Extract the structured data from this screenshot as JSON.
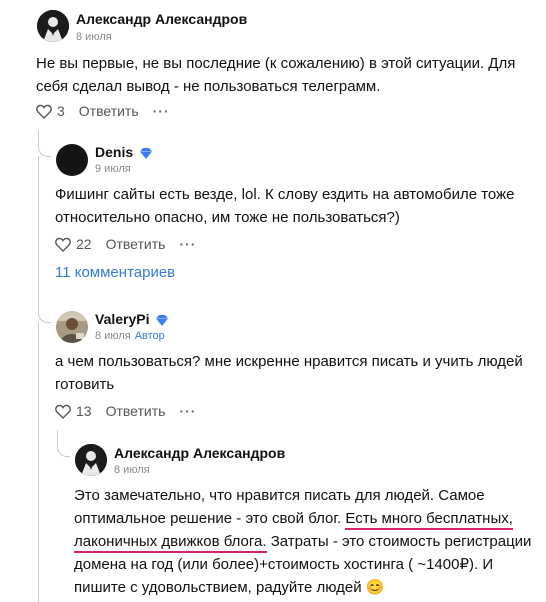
{
  "comments": [
    {
      "author": "Александр Александров",
      "date": "8 июля",
      "text_lines": [
        "Не вы первые, не вы последние (к сожалению) в этой ситуации. Для",
        "себя сделал вывод - не пользоваться телеграмм."
      ],
      "likes": "3",
      "reply_label": "Ответить",
      "more_label": "···"
    },
    {
      "author": "Denis",
      "date": "9 июля",
      "text_lines": [
        "Фишинг сайты есть везде, lol. К слову ездить на автомобиле тоже",
        "относительно опасно, им тоже не пользоваться?)"
      ],
      "likes": "22",
      "reply_label": "Ответить",
      "more_label": "···",
      "replies_link": "11 комментариев"
    },
    {
      "author": "ValeryPi",
      "date": "8 июля",
      "badge": "Автор",
      "text_lines": [
        "а чем пользоваться? мне искренне нравится писать и учить людей",
        "готовить"
      ],
      "likes": "13",
      "reply_label": "Ответить",
      "more_label": "···"
    },
    {
      "author": "Александр Александров",
      "date": "8 июля",
      "text": {
        "l1": "Это замечательно, что нравится писать для людей. Самое",
        "l2a": "оптимальное решение - это свой блог. ",
        "l2b": "Есть много бесплатных,",
        "l3a": "лаконичных движков блога.",
        "l3b": " Затраты - это стоимость регистрации",
        "l4": "домена на год (или более)+стоимость хостинга ( ~1400₽). И",
        "l5": "пишите с удовольствием, радуйте людей",
        "emoji": "😊"
      }
    }
  ],
  "colors": {
    "link": "#3a7bd5",
    "highlight": "#d6226d",
    "verified": "#3d7bf5"
  }
}
